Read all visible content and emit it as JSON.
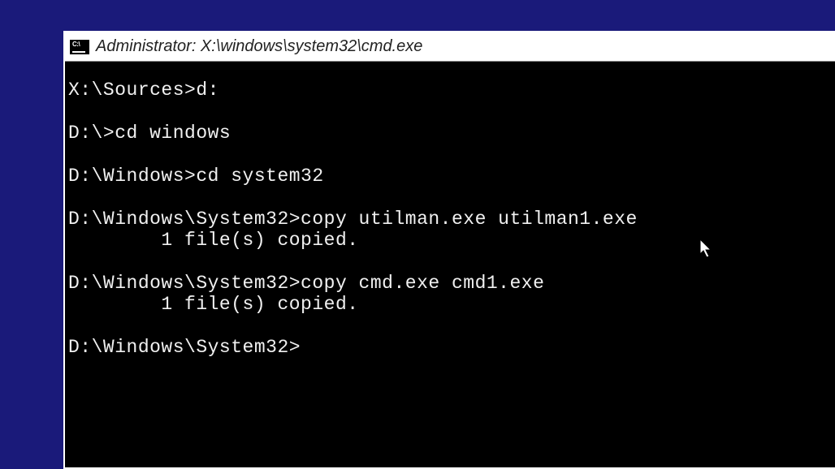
{
  "window": {
    "title": "Administrator: X:\\windows\\system32\\cmd.exe"
  },
  "terminal": {
    "lines": [
      "X:\\Sources>d:",
      "",
      "D:\\>cd windows",
      "",
      "D:\\Windows>cd system32",
      "",
      "D:\\Windows\\System32>copy utilman.exe utilman1.exe",
      "        1 file(s) copied.",
      "",
      "D:\\Windows\\System32>copy cmd.exe cmd1.exe",
      "        1 file(s) copied.",
      "",
      "D:\\Windows\\System32>"
    ]
  }
}
